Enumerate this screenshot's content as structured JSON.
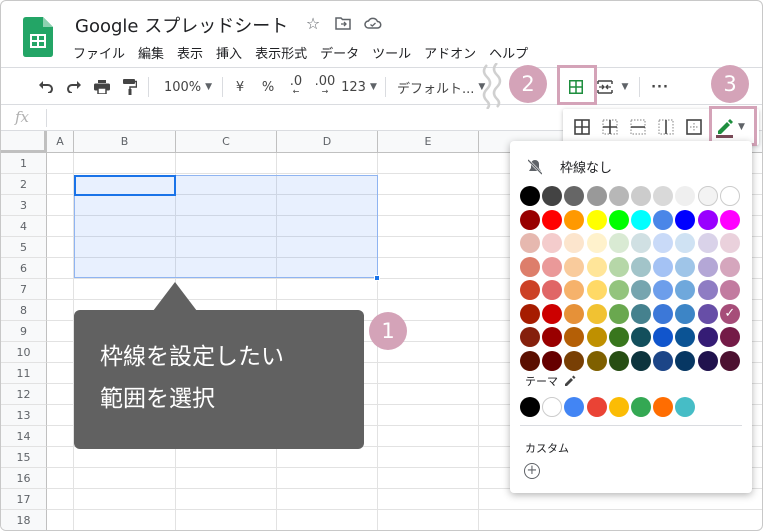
{
  "app": {
    "doc_title": "Google スプレッドシート",
    "menu": [
      "ファイル",
      "編集",
      "表示",
      "挿入",
      "表示形式",
      "データ",
      "ツール",
      "アドオン",
      "ヘルプ"
    ]
  },
  "toolbar": {
    "zoom": "100%",
    "currency": "¥",
    "percent": "%",
    "dec_less": ".0",
    "dec_more": ".00",
    "number_format": "123",
    "font": "デフォルト..."
  },
  "formula_bar": {
    "fx_label": "fx"
  },
  "sheet": {
    "columns": [
      "A",
      "B",
      "C",
      "D",
      "E"
    ],
    "rows": [
      "1",
      "2",
      "3",
      "4",
      "5",
      "6",
      "7",
      "8",
      "9",
      "10",
      "11",
      "12",
      "13",
      "14",
      "15",
      "16",
      "17",
      "18"
    ]
  },
  "callout": {
    "line1": "枠線を設定したい",
    "line2": "範囲を選択"
  },
  "badges": [
    "1",
    "2",
    "3"
  ],
  "palette": {
    "no_border": "枠線なし",
    "theme_label": "テーマ",
    "custom_label": "カスタム",
    "standard_colors": [
      [
        "#000000",
        "#434343",
        "#666666",
        "#999999",
        "#b7b7b7",
        "#cccccc",
        "#d9d9d9",
        "#efefef",
        "#f3f3f3",
        "#ffffff"
      ],
      [
        "#980000",
        "#ff0000",
        "#ff9900",
        "#ffff00",
        "#00ff00",
        "#00ffff",
        "#4a86e8",
        "#0000ff",
        "#9900ff",
        "#ff00ff"
      ],
      [
        "#e6b8af",
        "#f4cccc",
        "#fce5cd",
        "#fff2cc",
        "#d9ead3",
        "#d0e0e3",
        "#c9daf8",
        "#cfe2f3",
        "#d9d2e9",
        "#ead1dc"
      ],
      [
        "#dd7e6b",
        "#ea9999",
        "#f9cb9c",
        "#ffe599",
        "#b6d7a8",
        "#a2c4c9",
        "#a4c2f4",
        "#9fc5e8",
        "#b4a7d6",
        "#d5a6bd"
      ],
      [
        "#cc4125",
        "#e06666",
        "#f6b26b",
        "#ffd966",
        "#93c47d",
        "#76a5af",
        "#6d9eeb",
        "#6fa8dc",
        "#8e7cc3",
        "#c27ba0"
      ],
      [
        "#a61c00",
        "#cc0000",
        "#e69138",
        "#f1c232",
        "#6aa84f",
        "#45818e",
        "#3c78d8",
        "#3d85c6",
        "#674ea7",
        "#a64d79"
      ],
      [
        "#85200c",
        "#990000",
        "#b45f06",
        "#bf9000",
        "#38761d",
        "#134f5c",
        "#1155cc",
        "#0b5394",
        "#351c75",
        "#741b47"
      ],
      [
        "#5b0f00",
        "#660000",
        "#783f04",
        "#7f6000",
        "#274e13",
        "#0c343d",
        "#1c4587",
        "#073763",
        "#20124d",
        "#4c1130"
      ]
    ],
    "theme_colors": [
      "#000000",
      "#ffffff",
      "#4285f4",
      "#ea4335",
      "#fbbc04",
      "#34a853",
      "#ff6d01",
      "#46bdc6"
    ]
  }
}
